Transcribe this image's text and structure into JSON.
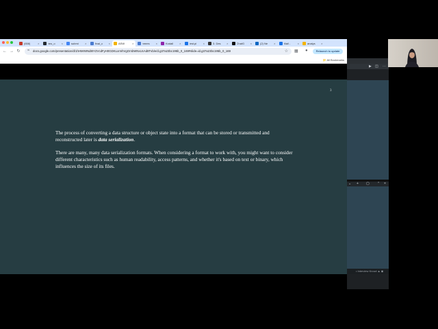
{
  "browser": {
    "tabs": [
      {
        "label": "(658)",
        "color": "#c53929"
      },
      {
        "label": "neo_o",
        "color": "#24292f"
      },
      {
        "label": "submi",
        "color": "#4285f4"
      },
      {
        "label": "final_c",
        "color": "#4a7bd0"
      },
      {
        "label": "ASW",
        "color": "#f4b400",
        "active": true
      },
      {
        "label": "nmres",
        "color": "#4a7bd0"
      },
      {
        "label": "Kodall",
        "color": "#8e24aa"
      },
      {
        "label": "test.pi",
        "color": "#1a73e8"
      },
      {
        "label": "3. Des",
        "color": "#333333"
      },
      {
        "label": "ChatG",
        "color": "#111111"
      },
      {
        "label": "(2) Ne",
        "color": "#0a66c2"
      },
      {
        "label": "Mail -",
        "color": "#1a73e8"
      },
      {
        "label": "analys",
        "color": "#f4b400"
      }
    ],
    "url": "docs.google.com/presentation/d/1hHMrWNd8IYZVcdFyH0GDKLxrmhVgOrnbWNxUcAd8Tvb/e/d.g37a23bc195b_0_169#slide=id.g37a23bc195b_0_169",
    "relaunch_label": "Relaunch to update",
    "all_bookmarks_label": "All Bookmarks",
    "colors": {
      "tabstrip": "#d3e3fd",
      "relaunch_bg": "#c2e7ff"
    }
  },
  "slide": {
    "number": "3",
    "paragraph1_text": "The process of converting a data structure or object state into a format that can be stored or transmitted and reconstructed later is ",
    "paragraph1_emphasis": "data serialization",
    "paragraph1_end": ".",
    "paragraph2": "There are many, many data serialization formats. When considering a format to work with, you might want to consider different characteristics such as human readability, access patterns, and whether it's based on text or binary, which influences the size of its files.",
    "colors": {
      "background": "#263d42",
      "text": "#ffffff"
    }
  },
  "editor": {
    "status_text": "• Interview Knowl ▲ ◉",
    "colors": {
      "panel": "#2e4553",
      "chrome": "#1e2124"
    }
  }
}
